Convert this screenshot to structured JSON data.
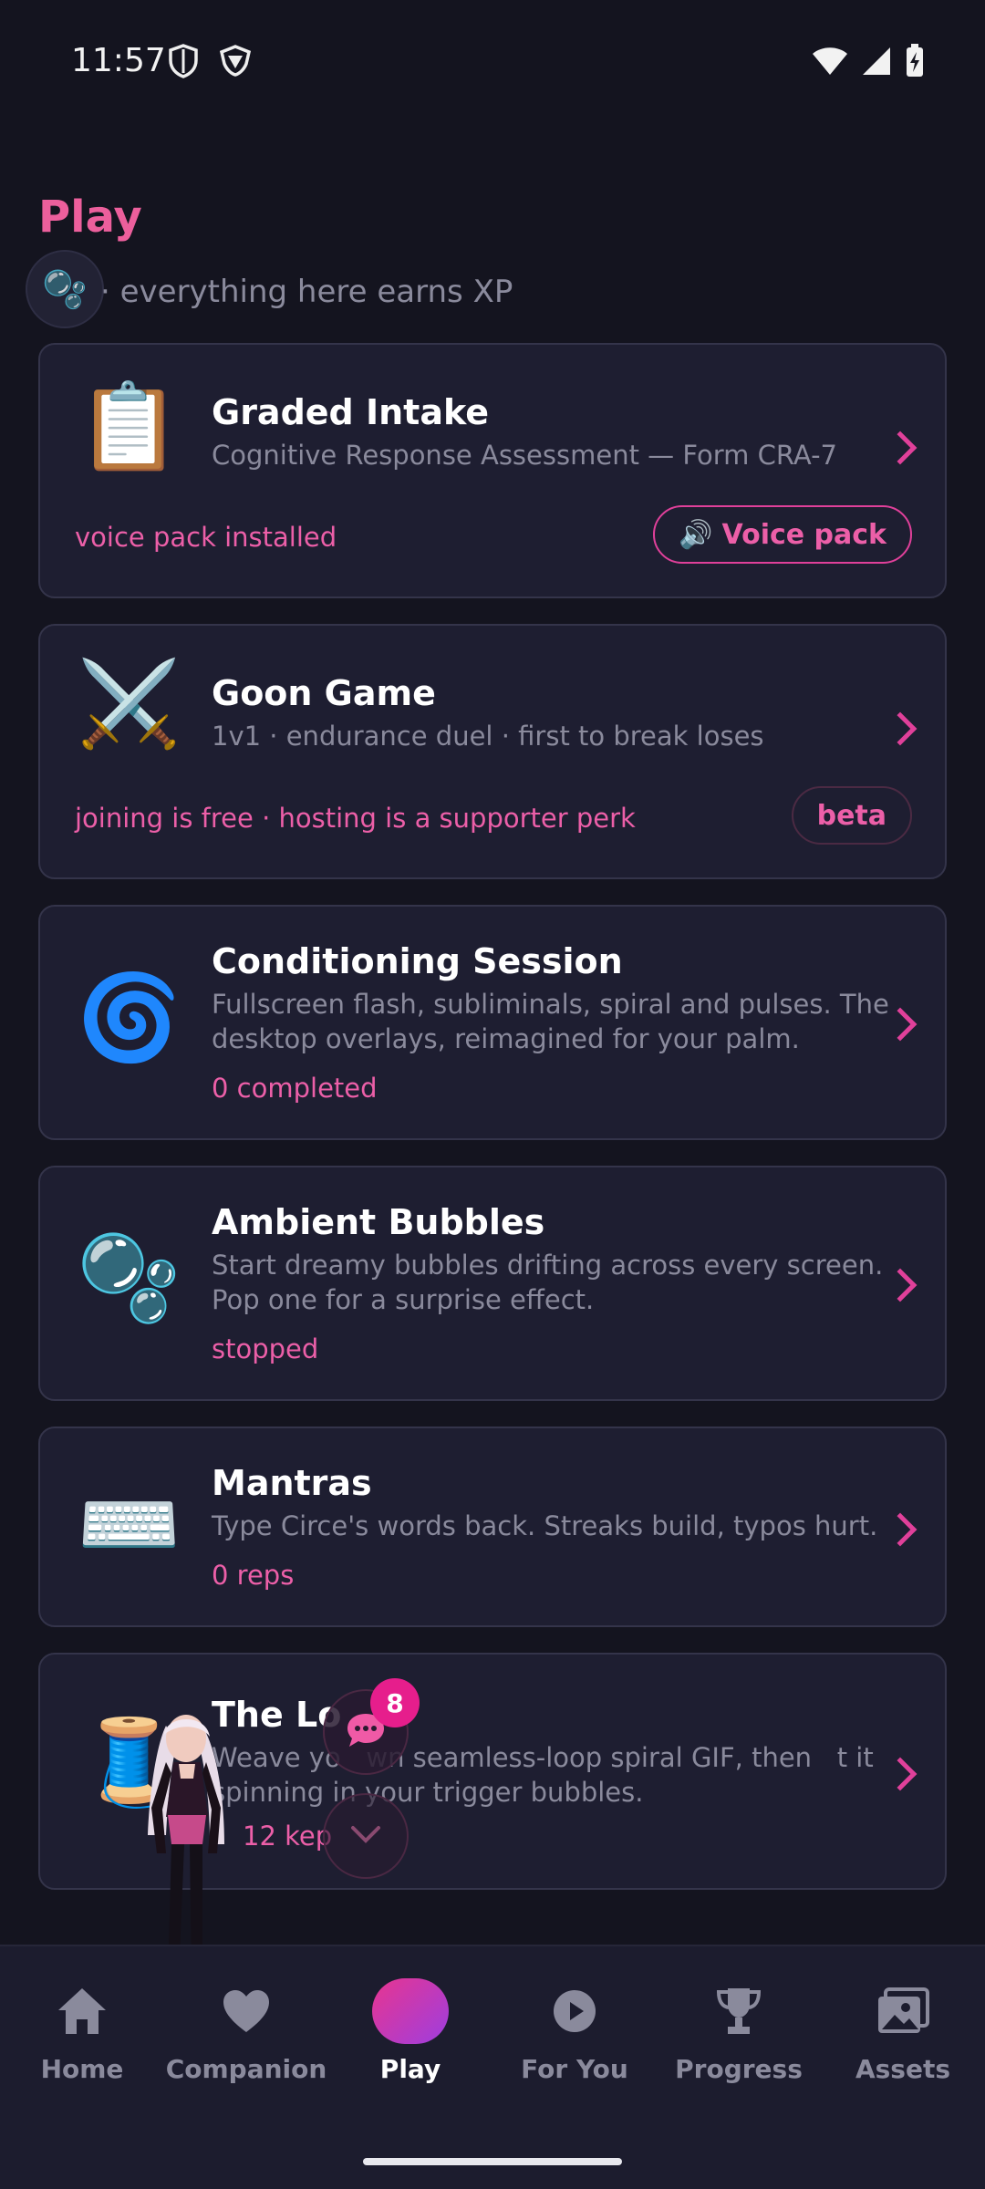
{
  "status_bar": {
    "time": "11:57"
  },
  "header": {
    "title": "Play",
    "subtitle": "· everything here earns XP"
  },
  "cards": [
    {
      "icon": "clipboard-icon",
      "emoji": "📋",
      "title": "Graded Intake",
      "desc": "Cognitive Response Assessment — Form CRA-7",
      "footer": "voice pack installed",
      "pill_icon": "🔊",
      "pill": "Voice pack"
    },
    {
      "icon": "crossed-swords-icon",
      "emoji": "⚔️",
      "title": "Goon Game",
      "desc": "1v1 · endurance duel · first to break loses",
      "footer": "joining is free · hosting is a supporter perk",
      "pill": "beta"
    },
    {
      "icon": "spiral-icon",
      "emoji": "🌀",
      "title": "Conditioning Session",
      "desc": "Fullscreen flash, subliminals, spiral and pulses. The desktop overlays, reimagined for your palm.",
      "status": "0 completed"
    },
    {
      "icon": "bubbles-icon",
      "emoji": "🫧",
      "title": "Ambient Bubbles",
      "desc": "Start dreamy bubbles drifting across every screen. Pop one for a surprise effect.",
      "status": "stopped"
    },
    {
      "icon": "keyboard-icon",
      "emoji": "⌨️",
      "title": "Mantras",
      "desc": "Type Circe's words back. Streaks build, typos hurt.",
      "status": "0 reps"
    },
    {
      "icon": "spool-icon",
      "emoji": "🧵",
      "title": "The Lo",
      "desc": "Weave yo   wn seamless-loop spiral GIF, then   t it spinning in your trigger bubbles.",
      "status": "12 kep"
    }
  ],
  "chat": {
    "badge": "8"
  },
  "nav": {
    "items": [
      {
        "label": "Home",
        "icon": "home-icon"
      },
      {
        "label": "Companion",
        "icon": "heart-icon"
      },
      {
        "label": "Play",
        "icon": "play-pill-icon"
      },
      {
        "label": "For You",
        "icon": "play-circle-icon"
      },
      {
        "label": "Progress",
        "icon": "trophy-icon"
      },
      {
        "label": "Assets",
        "icon": "gallery-icon"
      }
    ],
    "active": "Play"
  },
  "colors": {
    "accent": "#ec5fa8",
    "background": "#14141f",
    "card": "#1e1e31"
  }
}
